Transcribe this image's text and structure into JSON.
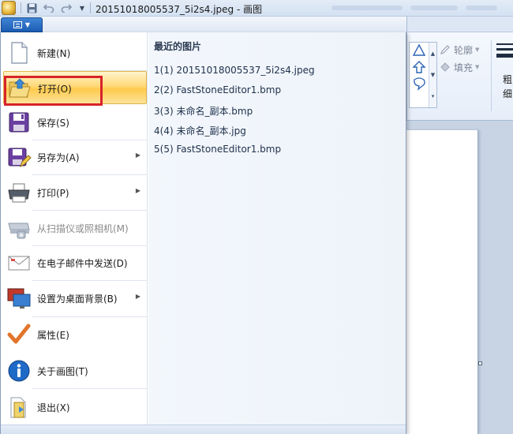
{
  "window": {
    "title": "20151018005537_5i2s4.jpeg - 画图"
  },
  "quick_access": {
    "save_icon": "floppy-icon",
    "undo_icon": "undo-icon",
    "redo_icon": "redo-icon",
    "customize_icon": "dropdown-icon"
  },
  "ribbon": {
    "outline_label": "轮廓",
    "fill_label": "填充",
    "thickness_label": "粗细"
  },
  "file_menu": {
    "items": [
      {
        "label": "新建(N)",
        "icon": "new-document-icon",
        "enabled": true,
        "submenu": false
      },
      {
        "label": "打开(O)",
        "icon": "open-folder-icon",
        "enabled": true,
        "submenu": false,
        "active": true
      },
      {
        "label": "保存(S)",
        "icon": "save-icon",
        "enabled": true,
        "submenu": false
      },
      {
        "label": "另存为(A)",
        "icon": "save-as-icon",
        "enabled": true,
        "submenu": true
      },
      {
        "label": "打印(P)",
        "icon": "printer-icon",
        "enabled": true,
        "submenu": true
      },
      {
        "label": "从扫描仪或照相机(M)",
        "icon": "scanner-icon",
        "enabled": false,
        "submenu": false
      },
      {
        "label": "在电子邮件中发送(D)",
        "icon": "email-icon",
        "enabled": true,
        "submenu": false
      },
      {
        "label": "设置为桌面背景(B)",
        "icon": "desktop-icon",
        "enabled": true,
        "submenu": true
      },
      {
        "label": "属性(E)",
        "icon": "checkmark-icon",
        "enabled": true,
        "submenu": false
      },
      {
        "label": "关于画图(T)",
        "icon": "info-icon",
        "enabled": true,
        "submenu": false
      },
      {
        "label": "退出(X)",
        "icon": "exit-icon",
        "enabled": true,
        "submenu": false
      }
    ],
    "recent_title": "最近的图片",
    "recent_files": [
      "1(1)  20151018005537_5i2s4.jpeg",
      "2(2)  FastStoneEditor1.bmp",
      "3(3)  未命名_副本.bmp",
      "4(4)  未命名_副本.jpg",
      "5(5)  FastStoneEditor1.bmp"
    ]
  },
  "colors": {
    "highlight_box": "#d8232a",
    "file_button": "#1c5db3",
    "active_item": "#ffd978"
  }
}
